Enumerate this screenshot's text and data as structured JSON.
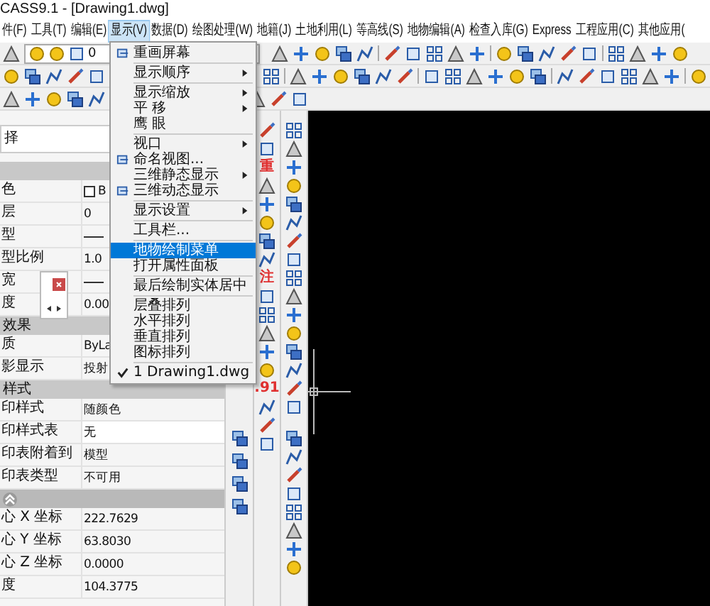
{
  "window": {
    "title": "CASS9.1 - [Drawing1.dwg]"
  },
  "menubar": [
    {
      "label": "件(F)",
      "selected": false
    },
    {
      "label": "工具(T)",
      "selected": false
    },
    {
      "label": "编辑(E)",
      "selected": false
    },
    {
      "label": "显示(V)",
      "selected": true
    },
    {
      "label": "数据(D)",
      "selected": false
    },
    {
      "label": "绘图处理(W)",
      "selected": false
    },
    {
      "label": "地籍(J)",
      "selected": false
    },
    {
      "label": "土地利用(L)",
      "selected": false
    },
    {
      "label": "等高线(S)",
      "selected": false
    },
    {
      "label": "地物编辑(A)",
      "selected": false
    },
    {
      "label": "检查入库(G)",
      "selected": false
    },
    {
      "label": "Express",
      "selected": false
    },
    {
      "label": "工程应用(C)",
      "selected": false
    },
    {
      "label": "其他应用(",
      "selected": false
    }
  ],
  "layer_dropdown": {
    "value": "0"
  },
  "properties": {
    "selection": "择",
    "sections": [
      {
        "collapsible": false,
        "rows": [
          {
            "label": "色",
            "value": "B",
            "kind": "swatch"
          },
          {
            "label": "层",
            "value": "0",
            "kind": "text"
          },
          {
            "label": "型",
            "kind": "line"
          },
          {
            "label": "型比例",
            "value": "1.0",
            "kind": "text"
          },
          {
            "label": "宽",
            "kind": "line"
          },
          {
            "label": "度",
            "value": "0.00",
            "kind": "text"
          }
        ]
      },
      {
        "title": "效果",
        "collapsible": false,
        "rows": [
          {
            "label": "质",
            "value": "ByLa",
            "kind": "text"
          },
          {
            "label": "影显示",
            "value": "投射",
            "kind": "text"
          }
        ]
      },
      {
        "title": "样式",
        "collapsible": false,
        "rows": [
          {
            "label": "印样式",
            "value": "随颜色",
            "kind": "text"
          },
          {
            "label": "印样式表",
            "value": "无",
            "kind": "field"
          },
          {
            "label": "印表附着到",
            "value": "模型",
            "kind": "text"
          },
          {
            "label": "印表类型",
            "value": "不可用",
            "kind": "text"
          }
        ]
      },
      {
        "collapsible": true,
        "rows": [
          {
            "label": "心 X 坐标",
            "value": "222.7629",
            "kind": "text"
          },
          {
            "label": "心 Y 坐标",
            "value": "63.8030",
            "kind": "text"
          },
          {
            "label": "心 Z 坐标",
            "value": "0.0000",
            "kind": "text"
          },
          {
            "label": "度",
            "value": "104.3775",
            "kind": "text"
          }
        ]
      }
    ]
  },
  "tool_column": [
    {
      "kind": "icon"
    },
    {
      "kind": "icon"
    },
    {
      "kind": "glyph",
      "text": "重"
    },
    {
      "kind": "icon"
    },
    {
      "kind": "icon"
    },
    {
      "kind": "icon"
    },
    {
      "kind": "icon"
    },
    {
      "kind": "icon"
    },
    {
      "kind": "glyph",
      "text": "注"
    },
    {
      "kind": "icon"
    },
    {
      "kind": "icon"
    },
    {
      "kind": "icon"
    },
    {
      "kind": "icon"
    },
    {
      "kind": "icon"
    },
    {
      "kind": "glyph",
      "text": ".91"
    },
    {
      "kind": "icon"
    },
    {
      "kind": "icon"
    },
    {
      "kind": "icon"
    }
  ],
  "menu": {
    "items": [
      {
        "kind": "item",
        "label": "重画屏幕",
        "icon": true,
        "submenu": false,
        "selected": false,
        "checked": false
      },
      {
        "kind": "separator"
      },
      {
        "kind": "item",
        "label": "显示顺序",
        "icon": false,
        "submenu": true,
        "selected": false,
        "checked": false
      },
      {
        "kind": "separator"
      },
      {
        "kind": "item",
        "label": "显示缩放",
        "icon": false,
        "submenu": true,
        "selected": false,
        "checked": false
      },
      {
        "kind": "item",
        "label": "平 移",
        "icon": false,
        "submenu": true,
        "selected": false,
        "checked": false
      },
      {
        "kind": "item",
        "label": "鹰 眼",
        "icon": false,
        "submenu": false,
        "selected": false,
        "checked": false
      },
      {
        "kind": "separator"
      },
      {
        "kind": "item",
        "label": "视口",
        "icon": false,
        "submenu": true,
        "selected": false,
        "checked": false
      },
      {
        "kind": "item",
        "label": "命名视图...",
        "icon": true,
        "submenu": false,
        "selected": false,
        "checked": false
      },
      {
        "kind": "item",
        "label": "三维静态显示",
        "icon": false,
        "submenu": true,
        "selected": false,
        "checked": false
      },
      {
        "kind": "item",
        "label": "三维动态显示",
        "icon": true,
        "submenu": false,
        "selected": false,
        "checked": false
      },
      {
        "kind": "separator"
      },
      {
        "kind": "item",
        "label": "显示设置",
        "icon": false,
        "submenu": true,
        "selected": false,
        "checked": false
      },
      {
        "kind": "separator"
      },
      {
        "kind": "item",
        "label": "工具栏...",
        "icon": false,
        "submenu": false,
        "selected": false,
        "checked": false
      },
      {
        "kind": "separator"
      },
      {
        "kind": "item",
        "label": "地物绘制菜单",
        "icon": false,
        "submenu": false,
        "selected": true,
        "checked": false
      },
      {
        "kind": "item",
        "label": "打开属性面板",
        "icon": false,
        "submenu": false,
        "selected": false,
        "checked": false
      },
      {
        "kind": "separator"
      },
      {
        "kind": "item",
        "label": "最后绘制实体居中",
        "icon": false,
        "submenu": false,
        "selected": false,
        "checked": false
      },
      {
        "kind": "separator"
      },
      {
        "kind": "item",
        "label": "层叠排列",
        "icon": false,
        "submenu": false,
        "selected": false,
        "checked": false
      },
      {
        "kind": "item",
        "label": "水平排列",
        "icon": false,
        "submenu": false,
        "selected": false,
        "checked": false
      },
      {
        "kind": "item",
        "label": "垂直排列",
        "icon": false,
        "submenu": false,
        "selected": false,
        "checked": false
      },
      {
        "kind": "item",
        "label": "图标排列",
        "icon": false,
        "submenu": false,
        "selected": false,
        "checked": false
      },
      {
        "kind": "separator"
      },
      {
        "kind": "item",
        "label": "1 Drawing1.dwg",
        "icon": false,
        "submenu": false,
        "selected": false,
        "checked": true
      }
    ]
  }
}
